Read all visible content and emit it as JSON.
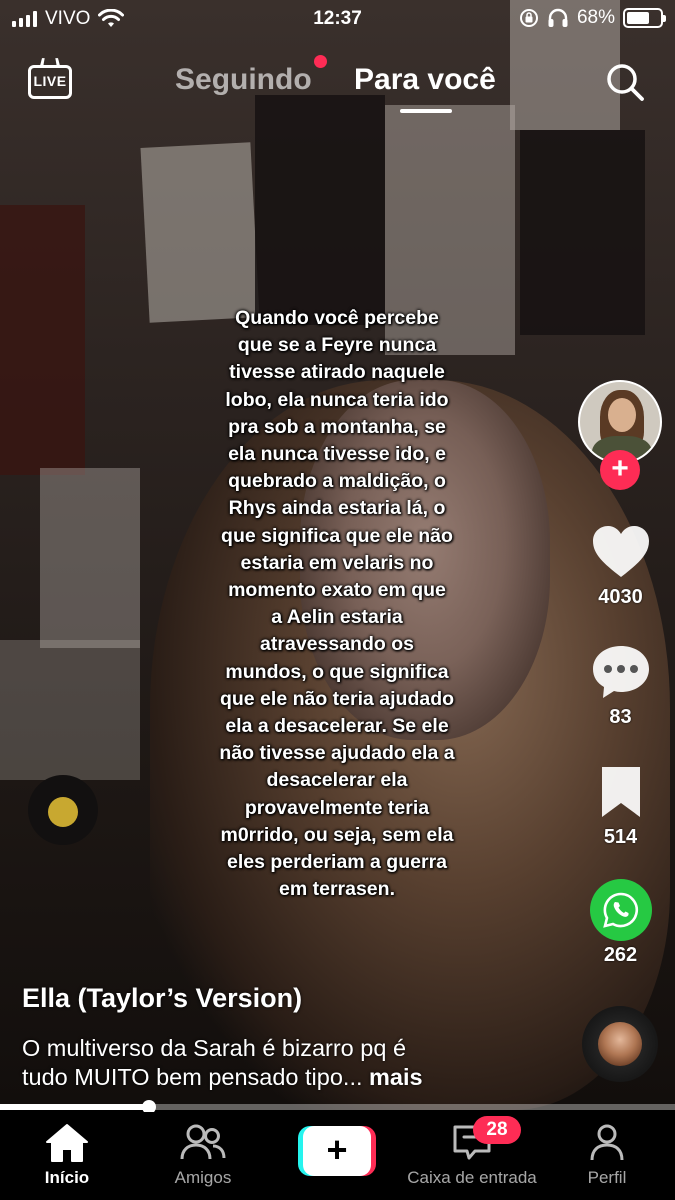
{
  "status_bar": {
    "carrier": "VIVO",
    "time": "12:37",
    "battery": "68%",
    "battery_level": 0.68
  },
  "top_tabs": {
    "live_label": "LIVE",
    "following_label": "Seguindo",
    "for_you_label": "Para você",
    "active_tab": "Para você"
  },
  "video": {
    "caption_lines": [
      "Quando você percebe",
      "que se a Feyre nunca",
      "tivesse atirado naquele",
      "lobo, ela nunca teria ido",
      "pra sob a montanha, se",
      "ela nunca tivesse ido, e",
      "quebrado a maldição, o",
      "Rhys ainda estaria lá, o",
      "que significa que ele não",
      "estaria em velaris no",
      "momento exato em que",
      "a Aelin estaria",
      "atravessando os",
      "mundos, o que significa",
      "que ele não teria ajudado",
      "ela a desacelerar. Se ele",
      "não tivesse ajudado ela a",
      "desacelerar ela",
      "provavelmente teria",
      "m0rrido, ou seja, sem ela",
      "eles perderiam a guerra",
      "em terrasen."
    ],
    "title": "Ella (Taylor’s Version)",
    "description_line1": "O multiverso da Sarah é bizarro pq é",
    "description_line2": "tudo MUITO bem pensado tipo... ",
    "more_label": "mais",
    "progress": 0.22
  },
  "actions": {
    "likes": "4030",
    "comments": "83",
    "saves": "514",
    "shares": "262"
  },
  "bottom_nav": {
    "home": "Início",
    "friends": "Amigos",
    "inbox": "Caixa de entrada",
    "inbox_badge": "28",
    "profile": "Perfil"
  },
  "colors": {
    "accent": "#fe2c55",
    "cyan": "#25f4ee",
    "whatsapp": "#26c943"
  }
}
